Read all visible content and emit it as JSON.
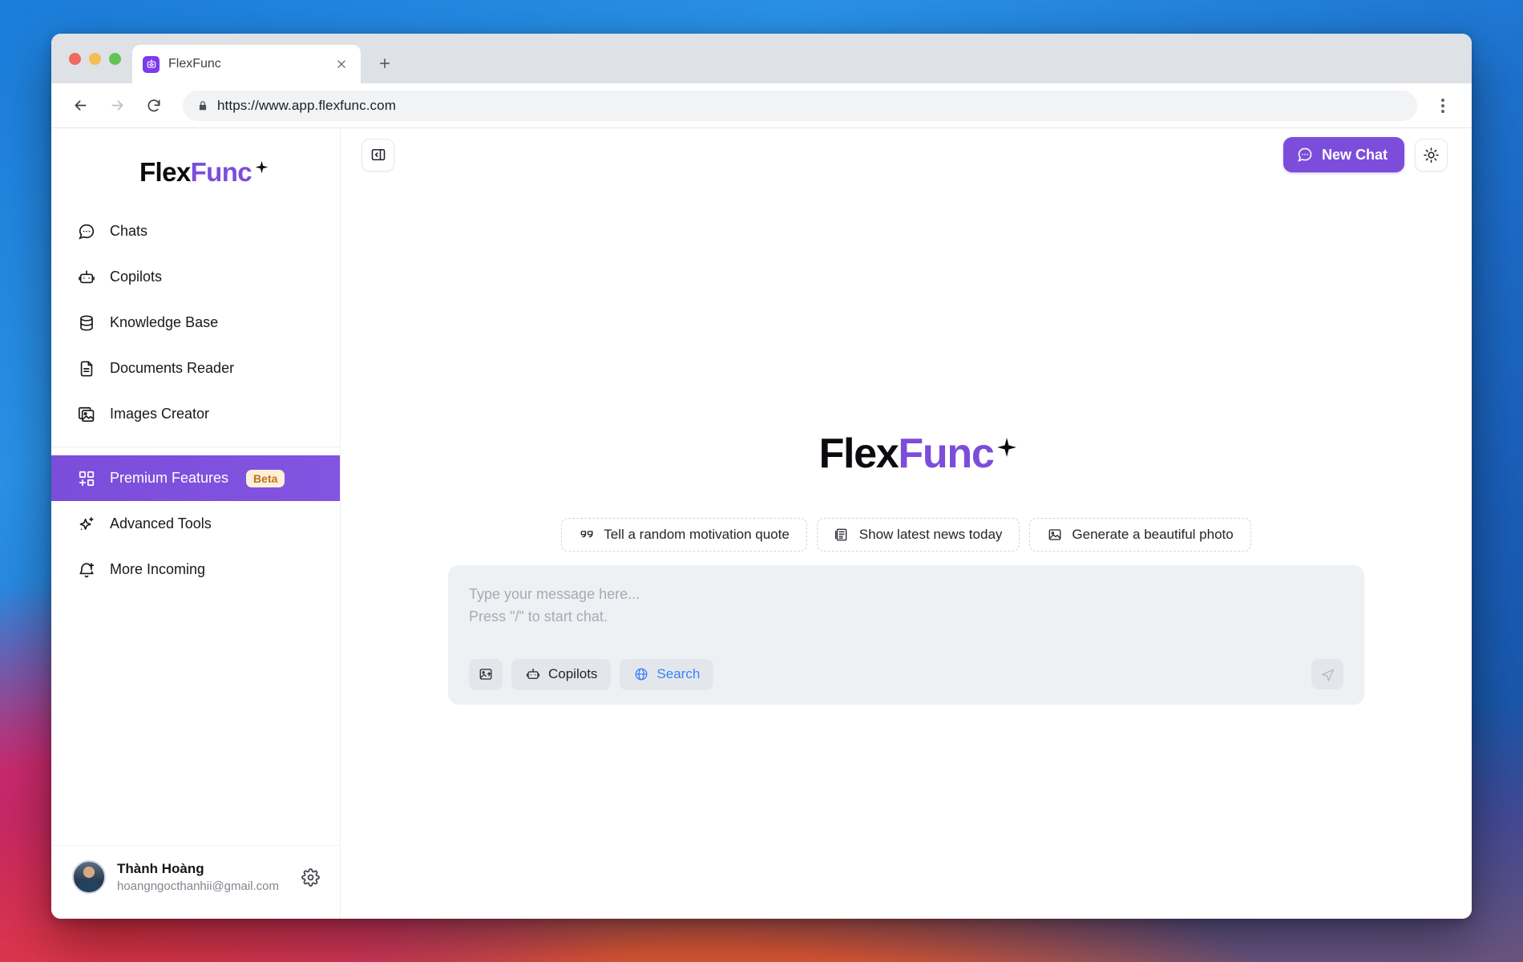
{
  "browser": {
    "tab": {
      "title": "FlexFunc",
      "favicon": "robot-icon",
      "close": "×"
    },
    "new_tab_label": "+",
    "url": "https://www.app.flexfunc.com",
    "lock": "lock-icon",
    "back": "back-arrow-icon",
    "forward": "forward-arrow-icon",
    "reload": "reload-icon",
    "menu": "kebab-menu-icon"
  },
  "sidebar": {
    "logo": {
      "part1": "Flex",
      "part2": "Func"
    },
    "items": [
      {
        "label": "Chats",
        "icon": "chat-bubble-icon",
        "active": false
      },
      {
        "label": "Copilots",
        "icon": "robot-icon",
        "active": false
      },
      {
        "label": "Knowledge Base",
        "icon": "database-icon",
        "active": false
      },
      {
        "label": "Documents Reader",
        "icon": "document-icon",
        "active": false
      },
      {
        "label": "Images Creator",
        "icon": "image-stack-icon",
        "active": false
      },
      {
        "label": "Premium Features",
        "icon": "grid-plus-icon",
        "active": true,
        "badge": "Beta"
      },
      {
        "label": "Advanced Tools",
        "icon": "sparkles-icon",
        "active": false
      },
      {
        "label": "More Incoming",
        "icon": "bell-plus-icon",
        "active": false
      }
    ],
    "profile": {
      "name": "Thành Hoàng",
      "email": "hoangngocthanhii@gmail.com",
      "settings_icon": "gear-icon",
      "avatar": "user-avatar"
    }
  },
  "header": {
    "collapse_icon": "panel-collapse-icon",
    "new_chat_label": "New Chat",
    "new_chat_icon": "chat-bubble-icon",
    "theme_icon": "sun-icon"
  },
  "main": {
    "logo": {
      "part1": "Flex",
      "part2": "Func"
    },
    "suggestions": [
      {
        "label": "Tell a random motivation quote",
        "icon": "quote-icon"
      },
      {
        "label": "Show latest news today",
        "icon": "newspaper-icon"
      },
      {
        "label": "Generate a beautiful photo",
        "icon": "image-icon"
      }
    ],
    "composer": {
      "placeholder_line1": "Type your message here...",
      "placeholder_line2": "Press \"/\" to start chat.",
      "value": "",
      "tools": [
        {
          "label": "",
          "icon": "image-upload-icon",
          "active": false
        },
        {
          "label": "Copilots",
          "icon": "robot-icon",
          "active": false
        },
        {
          "label": "Search",
          "icon": "globe-icon",
          "active": true
        }
      ],
      "send_icon": "send-icon"
    }
  },
  "colors": {
    "accent": "#7c4ddb",
    "badge_text": "#c2721a",
    "badge_bg": "#fdefd9",
    "search_active": "#3b82f6"
  }
}
